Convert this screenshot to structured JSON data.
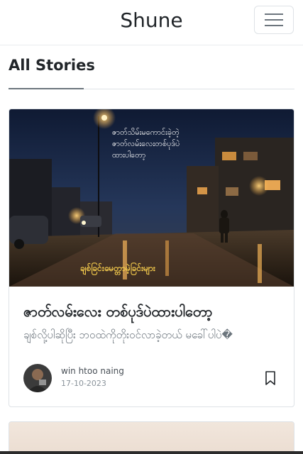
{
  "navbar": {
    "brand": "Shune",
    "toggle_icon": "hamburger-menu-icon"
  },
  "section": {
    "title": "All Stories"
  },
  "stories": [
    {
      "image": {
        "caption_lines": [
          "ဇာတ်သိမ်းမကောင်းခဲ့တဲ့",
          "ဇာတ်လမ်းလေးတစ်ပုဒ်ပဲ",
          "ထားပါတော့"
        ],
        "footer_text": "ချစ်ခြင်းမေတ္တာမဲ့ခြင်းများ",
        "colors": {
          "sky": "#1d2d4d",
          "street_glow": "#e0a04a",
          "caption": "#ffffff",
          "footer_text": "#f2c94c"
        }
      },
      "title": "ဇာတ်လမ်းလေး တစ်ပုဒ်ပဲထားပါတော့",
      "excerpt": "ချစ်လို့ပါဆိုပြီး ဘဝထဲကိုတိုးဝင်လာခဲ့တယ် မခေါ်ပါပဲ�",
      "author": "win htoo naing",
      "date": "17-10-2023",
      "bookmark_icon": "bookmark-icon"
    }
  ]
}
